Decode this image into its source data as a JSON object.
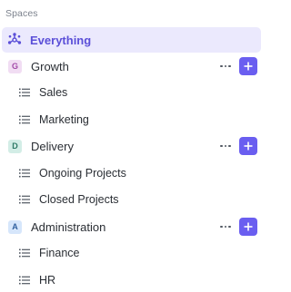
{
  "section_title": "Spaces",
  "everything": {
    "label": "Everything",
    "icon": "everything-icon"
  },
  "spaces": [
    {
      "badge": "G",
      "name": "Growth",
      "badge_bg": "#f1ddf3",
      "badge_fg": "#a24aa8",
      "lists": [
        "Sales",
        "Marketing"
      ]
    },
    {
      "badge": "D",
      "name": "Delivery",
      "badge_bg": "#d3ede6",
      "badge_fg": "#2e7a66",
      "lists": [
        "Ongoing Projects",
        "Closed Projects"
      ]
    },
    {
      "badge": "A",
      "name": "Administration",
      "badge_bg": "#d6e6fb",
      "badge_fg": "#2f5f9e",
      "lists": [
        "Finance",
        "HR"
      ]
    }
  ],
  "colors": {
    "accent": "#6a5ef0",
    "selected_bg": "#ebe9fd",
    "selected_text": "#5b4fd8"
  }
}
